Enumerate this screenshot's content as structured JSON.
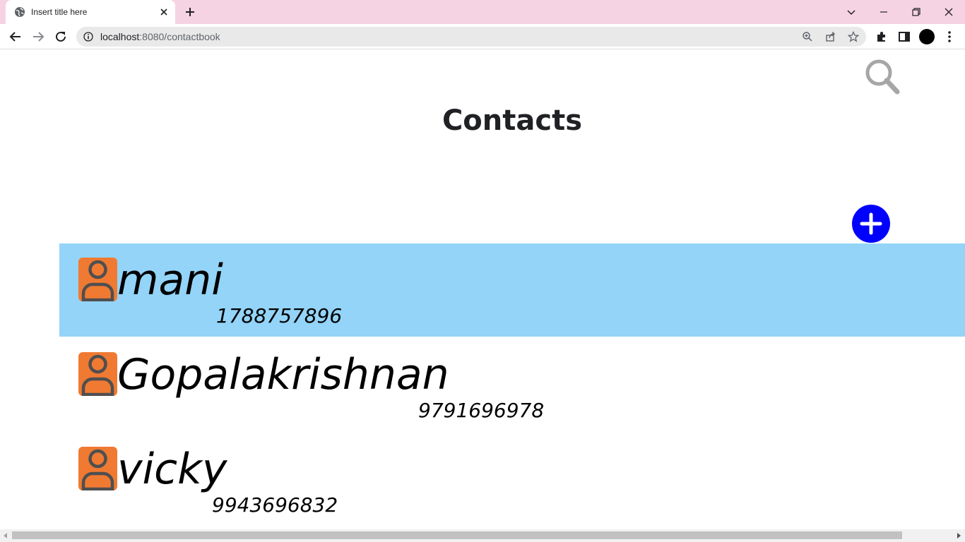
{
  "browser": {
    "tab_title": "Insert title here",
    "url_host": "localhost",
    "url_path": ":8080/contactbook"
  },
  "page": {
    "title": "Contacts"
  },
  "contacts": [
    {
      "name": "mani",
      "phone": "1788757896",
      "selected": true
    },
    {
      "name": "Gopalakrishnan",
      "phone": "9791696978",
      "selected": false
    },
    {
      "name": "vicky",
      "phone": "9943696832",
      "selected": false
    }
  ],
  "colors": {
    "accent_add_button": "#0000ff",
    "selected_row": "#93d4f8",
    "avatar": "#f07a32",
    "tab_strip": "#f6d3e2"
  }
}
